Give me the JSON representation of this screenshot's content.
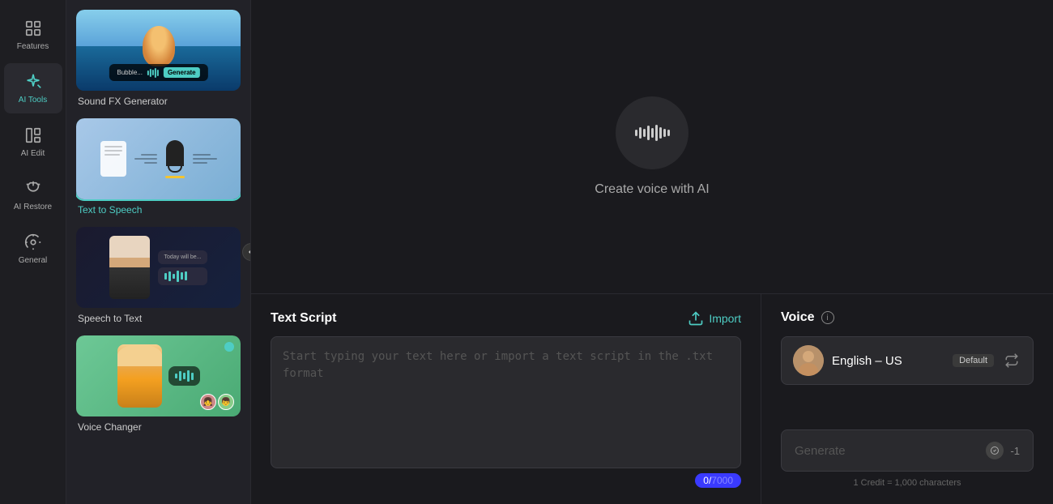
{
  "sidebar": {
    "items": [
      {
        "id": "features",
        "label": "Features",
        "icon": "grid-icon",
        "active": false
      },
      {
        "id": "ai-tools",
        "label": "AI Tools",
        "icon": "wand-icon",
        "active": true
      },
      {
        "id": "ai-edit",
        "label": "AI Edit",
        "icon": "edit-icon",
        "active": false
      },
      {
        "id": "ai-restore",
        "label": "AI Restore",
        "icon": "restore-icon",
        "active": false
      },
      {
        "id": "general",
        "label": "General",
        "icon": "general-icon",
        "active": false
      }
    ]
  },
  "tool_panel": {
    "tools": [
      {
        "id": "sound-fx",
        "title": "Sound FX Generator",
        "active": false
      },
      {
        "id": "text-to-speech",
        "title": "Text to Speech",
        "active": true
      },
      {
        "id": "speech-to-text",
        "title": "Speech to Text",
        "active": false
      },
      {
        "id": "voice-changer",
        "title": "Voice Changer",
        "active": false
      }
    ]
  },
  "preview": {
    "create_voice_text": "Create voice with AI"
  },
  "text_script": {
    "title": "Text Script",
    "import_label": "Import",
    "placeholder": "Start typing your text here or import a text script in the .txt format",
    "char_current": "0",
    "char_total": "7000"
  },
  "voice": {
    "title": "Voice",
    "voice_name": "English – US",
    "default_badge": "Default",
    "generate_label": "Generate",
    "credit_cost": "-1",
    "credit_info": "1 Credit = 1,000 characters"
  }
}
